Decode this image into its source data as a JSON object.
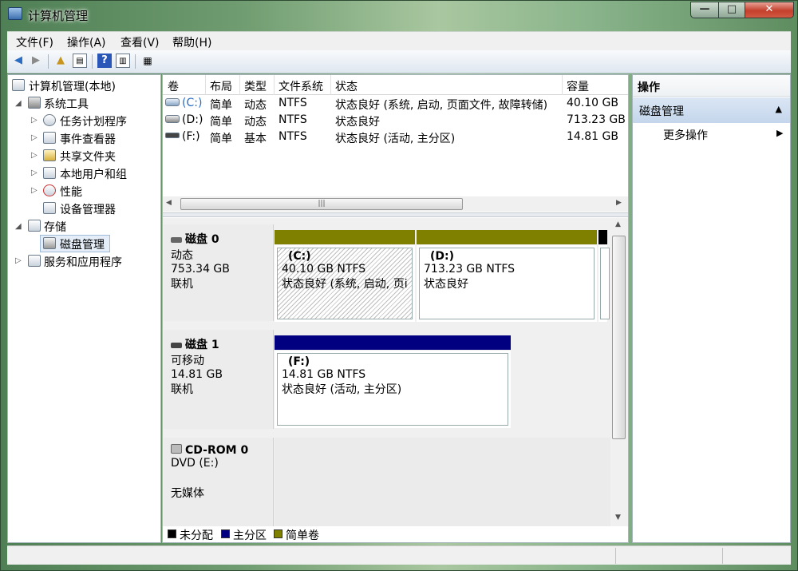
{
  "window": {
    "title": "计算机管理"
  },
  "menu": [
    "文件(F)",
    "操作(A)",
    "查看(V)",
    "帮助(H)"
  ],
  "tree": {
    "root": "计算机管理(本地)",
    "system_tools": "系统工具",
    "task_scheduler": "任务计划程序",
    "event_viewer": "事件查看器",
    "shared_folders": "共享文件夹",
    "local_users": "本地用户和组",
    "performance": "性能",
    "device_manager": "设备管理器",
    "storage": "存储",
    "disk_management": "磁盘管理",
    "services": "服务和应用程序"
  },
  "volume_table": {
    "headers": [
      "卷",
      "布局",
      "类型",
      "文件系统",
      "状态",
      "容量"
    ],
    "rows": [
      [
        "(C:)",
        "简单",
        "动态",
        "NTFS",
        "状态良好 (系统, 启动, 页面文件, 故障转储)",
        "40.10 GB"
      ],
      [
        "(D:)",
        "简单",
        "动态",
        "NTFS",
        "状态良好",
        "713.23 GB"
      ],
      [
        "(F:)",
        "简单",
        "基本",
        "NTFS",
        "状态良好 (活动, 主分区)",
        "14.81 GB"
      ]
    ]
  },
  "disks": [
    {
      "name": "磁盘 0",
      "type": "动态",
      "size": "753.34 GB",
      "status": "联机",
      "partitions": [
        {
          "label": "(C:)",
          "size": "40.10 GB NTFS",
          "status": "状态良好 (系统, 启动, 页i"
        },
        {
          "label": "(D:)",
          "size": "713.23 GB NTFS",
          "status": "状态良好"
        }
      ]
    },
    {
      "name": "磁盘 1",
      "type": "可移动",
      "size": "14.81 GB",
      "status": "联机",
      "partitions": [
        {
          "label": "(F:)",
          "size": "14.81 GB NTFS",
          "status": "状态良好 (活动, 主分区)"
        }
      ]
    },
    {
      "name": "CD-ROM 0",
      "type": "DVD (E:)",
      "size": "",
      "status": "无媒体",
      "partitions": []
    }
  ],
  "legend": [
    {
      "label": "未分配",
      "color": "#000000"
    },
    {
      "label": "主分区",
      "color": "#000080"
    },
    {
      "label": "简单卷",
      "color": "#808000"
    }
  ],
  "actions": {
    "header": "操作",
    "section": "磁盘管理",
    "more": "更多操作"
  },
  "colors": {
    "simple": "#808000",
    "primary": "#000080",
    "unallocated": "#000000",
    "selection": "#c4d6ec"
  }
}
